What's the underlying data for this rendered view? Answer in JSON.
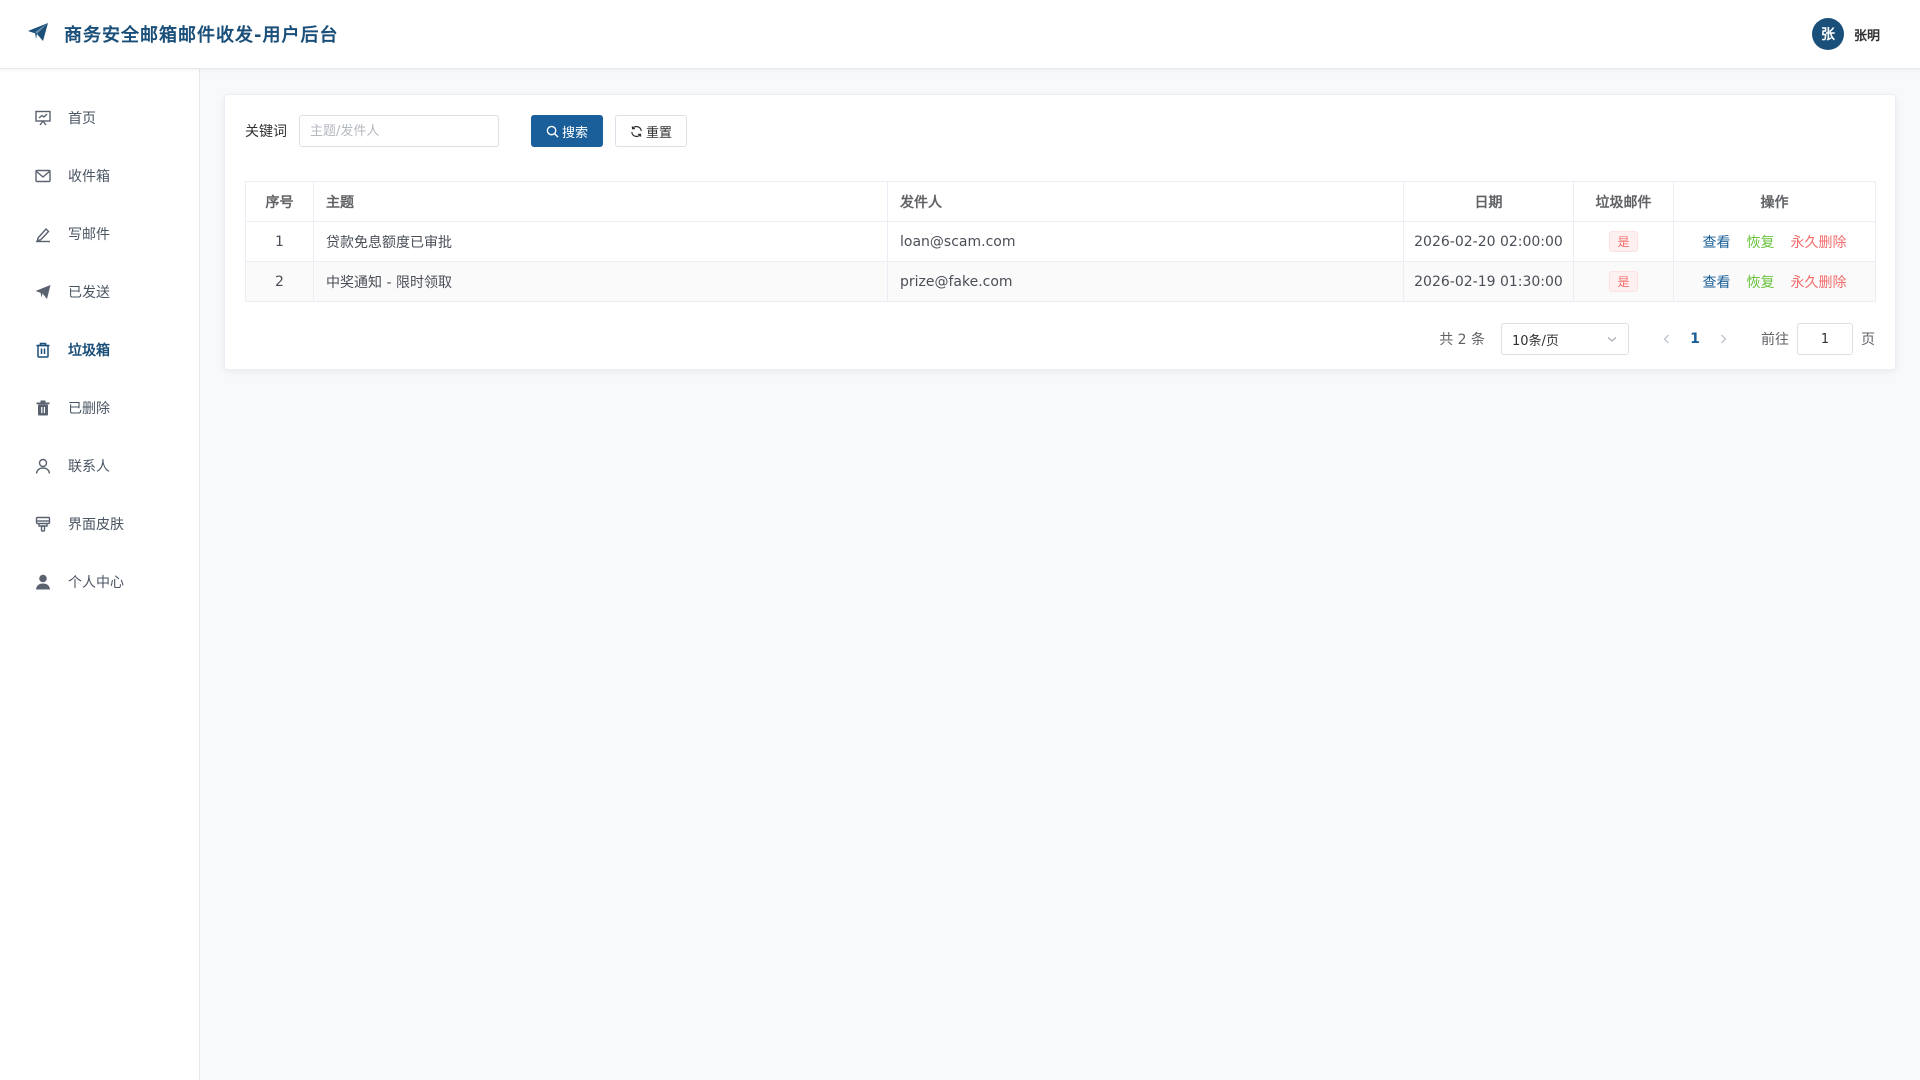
{
  "header": {
    "title": "商务安全邮箱邮件收发-用户后台",
    "user": {
      "avatar_text": "张",
      "name": "张明"
    },
    "brand_color": "#1a4f7a"
  },
  "sidebar": {
    "items": [
      {
        "label": "首页",
        "icon": "presentation-icon",
        "active": false
      },
      {
        "label": "收件箱",
        "icon": "envelope-icon",
        "active": false
      },
      {
        "label": "写邮件",
        "icon": "pen-icon",
        "active": false
      },
      {
        "label": "已发送",
        "icon": "paper-plane-icon",
        "active": false
      },
      {
        "label": "垃圾箱",
        "icon": "trash-icon",
        "active": true
      },
      {
        "label": "已删除",
        "icon": "trash-filled-icon",
        "active": false
      },
      {
        "label": "联系人",
        "icon": "user-outline-icon",
        "active": false
      },
      {
        "label": "界面皮肤",
        "icon": "brush-icon",
        "active": false
      },
      {
        "label": "个人中心",
        "icon": "user-filled-icon",
        "active": false
      }
    ]
  },
  "search": {
    "label": "关键词",
    "placeholder": "主题/发件人",
    "value": "",
    "search_label": "搜索",
    "reset_label": "重置"
  },
  "table": {
    "columns": [
      "序号",
      "主题",
      "发件人",
      "日期",
      "垃圾邮件",
      "操作"
    ],
    "rows": [
      {
        "index": "1",
        "subject": "贷款免息额度已审批",
        "sender": "loan@scam.com",
        "date": "2026-02-20 02:00:00",
        "spam": "是"
      },
      {
        "index": "2",
        "subject": "中奖通知 - 限时领取",
        "sender": "prize@fake.com",
        "date": "2026-02-19 01:30:00",
        "spam": "是"
      }
    ],
    "actions": {
      "view": "查看",
      "restore": "恢复",
      "delete": "永久删除"
    }
  },
  "pagination": {
    "total_text": "共 2 条",
    "page_size": "10条/页",
    "current_page": "1",
    "goto_label": "前往",
    "goto_value": "1",
    "page_unit": "页"
  },
  "colors": {
    "primary": "#1a5f99",
    "success": "#67c23a",
    "danger": "#f56c6c"
  }
}
